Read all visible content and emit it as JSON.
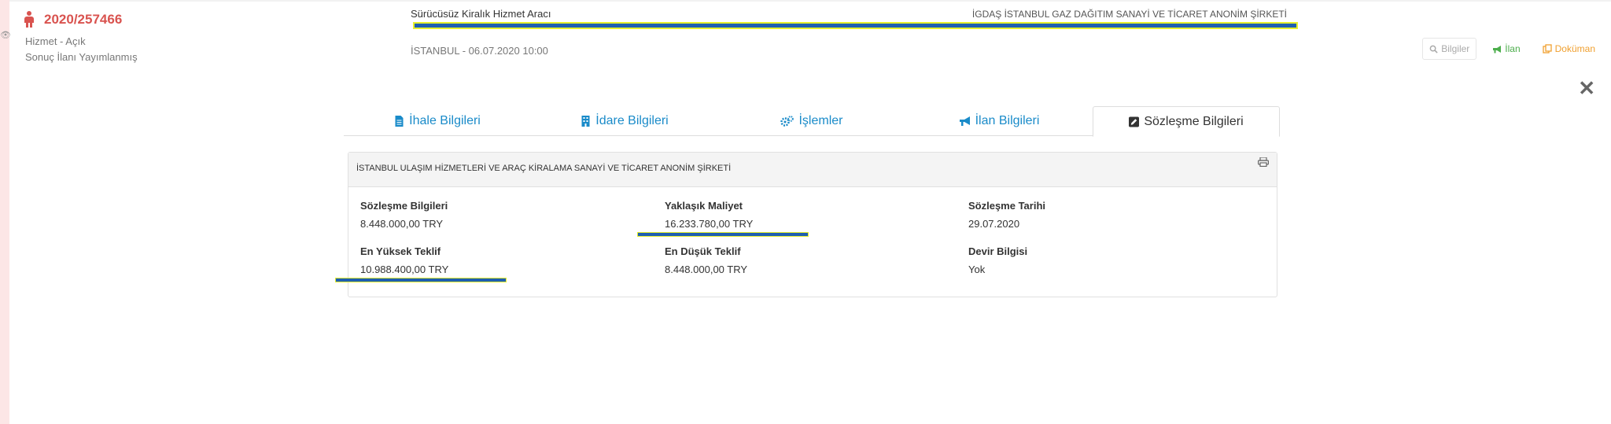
{
  "tender": {
    "reference": "2020/257466",
    "type": "Hizmet - Açık",
    "state": "Sonuç İlanı Yayımlanmış"
  },
  "header": {
    "title": "Sürücüsüz Kiralık Hizmet Aracı",
    "organization": "İGDAŞ İSTANBUL GAZ DAĞITIM SANAYİ VE TİCARET ANONİM ŞİRKETİ",
    "location_date": "İSTANBUL - 06.07.2020 10:00"
  },
  "actions": {
    "info": "Bilgiler",
    "announcement": "İlan",
    "document": "Doküman",
    "close": "✕"
  },
  "tabs": [
    {
      "label": "İhale Bilgileri",
      "icon": "file-icon"
    },
    {
      "label": "İdare Bilgileri",
      "icon": "building-icon"
    },
    {
      "label": "İşlemler",
      "icon": "gears-icon"
    },
    {
      "label": "İlan Bilgileri",
      "icon": "bullhorn-icon"
    },
    {
      "label": "Sözleşme Bilgileri",
      "icon": "edit-icon",
      "active": true
    }
  ],
  "panel": {
    "title": "İSTANBUL ULAŞIM HİZMETLERİ VE ARAÇ KİRALAMA SANAYİ VE TİCARET ANONİM ŞİRKETİ",
    "fields": [
      {
        "label": "Sözleşme Bilgileri",
        "value": "8.448.000,00 TRY"
      },
      {
        "label": "Yaklaşık Maliyet",
        "value": "16.233.780,00 TRY"
      },
      {
        "label": "Sözleşme Tarihi",
        "value": "29.07.2020"
      },
      {
        "label": "En Yüksek Teklif",
        "value": "10.988.400,00 TRY"
      },
      {
        "label": "En Düşük Teklif",
        "value": "8.448.000,00 TRY"
      },
      {
        "label": "Devir Bilgisi",
        "value": "Yok"
      }
    ]
  },
  "colors": {
    "accent": "#1a8bc9",
    "reference": "#d9534f",
    "highlight_fill": "#1f5fb0",
    "highlight_border": "#e6ef2e"
  }
}
